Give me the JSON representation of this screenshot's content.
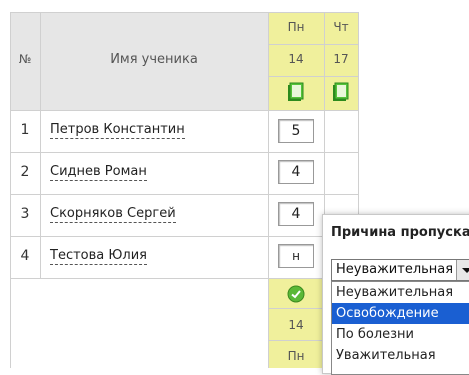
{
  "table": {
    "header": {
      "num_label": "№",
      "name_label": "Имя ученика",
      "days": [
        {
          "weekday": "Пн",
          "date": "14"
        },
        {
          "weekday": "Чт",
          "date": "17"
        }
      ]
    },
    "rows": [
      {
        "num": "1",
        "name": "Петров Константин",
        "grade": "5"
      },
      {
        "num": "2",
        "name": "Сиднев Роман",
        "grade": "4"
      },
      {
        "num": "3",
        "name": "Скорняков Сергей",
        "grade": "4"
      },
      {
        "num": "4",
        "name": "Тестова Юлия",
        "grade": "н"
      }
    ],
    "footer": {
      "date": "14",
      "weekday": "Пн"
    }
  },
  "popup": {
    "title": "Причина пропуска",
    "selected": "Неуважительная",
    "options": [
      "Неуважительная",
      "Освобождение",
      "По болезни",
      "Уважительная"
    ],
    "highlighted_index": 1
  },
  "colors": {
    "header_gray": "#e6e6e6",
    "header_yellow": "#f0f09c",
    "highlight": "#1a5fd2"
  }
}
